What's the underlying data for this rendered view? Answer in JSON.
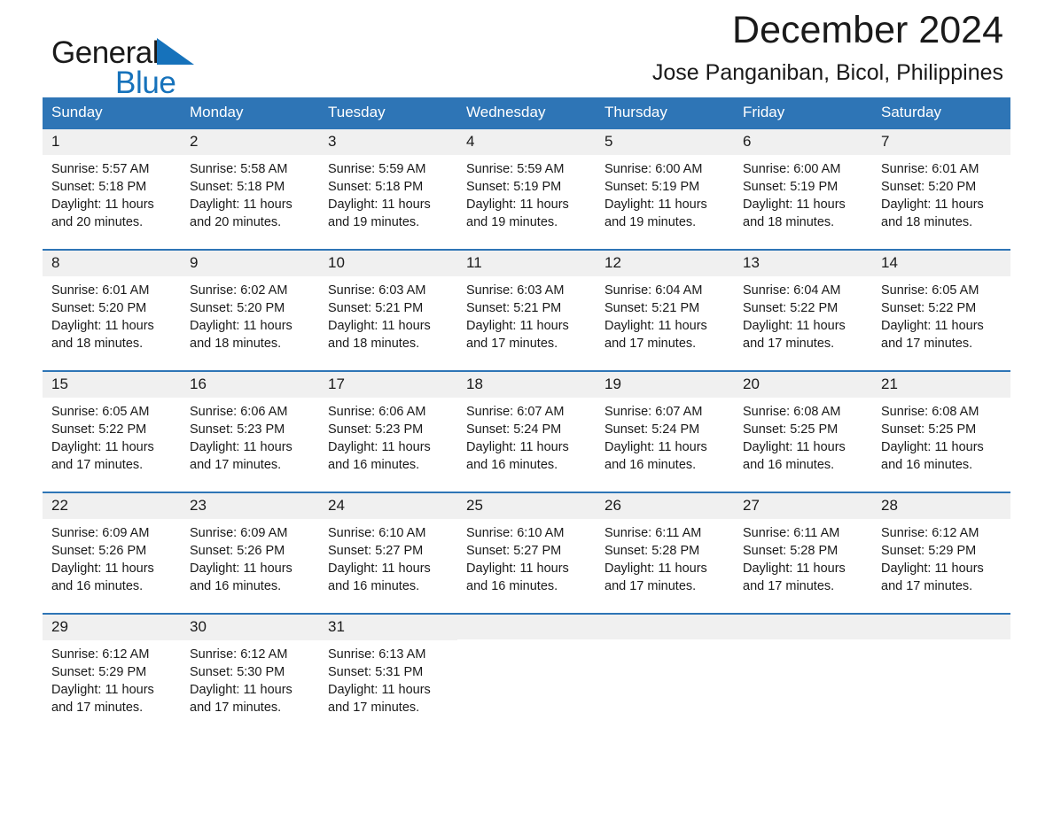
{
  "brand": {
    "name_part1": "General",
    "name_part2": "Blue",
    "triangle_icon": "brand-triangle-icon",
    "colors": {
      "black": "#1a1a1a",
      "blue": "#1672bb"
    }
  },
  "header": {
    "title": "December 2024",
    "subtitle": "Jose Panganiban, Bicol, Philippines"
  },
  "colors": {
    "header_blue": "#2e75b6",
    "date_band": "#f0f0f0",
    "text": "#1a1a1a",
    "header_text": "#ffffff"
  },
  "weekdays": [
    "Sunday",
    "Monday",
    "Tuesday",
    "Wednesday",
    "Thursday",
    "Friday",
    "Saturday"
  ],
  "weeks": [
    [
      {
        "day": "1",
        "sunrise": "Sunrise: 5:57 AM",
        "sunset": "Sunset: 5:18 PM",
        "daylight_line1": "Daylight: 11 hours",
        "daylight_line2": "and 20 minutes."
      },
      {
        "day": "2",
        "sunrise": "Sunrise: 5:58 AM",
        "sunset": "Sunset: 5:18 PM",
        "daylight_line1": "Daylight: 11 hours",
        "daylight_line2": "and 20 minutes."
      },
      {
        "day": "3",
        "sunrise": "Sunrise: 5:59 AM",
        "sunset": "Sunset: 5:18 PM",
        "daylight_line1": "Daylight: 11 hours",
        "daylight_line2": "and 19 minutes."
      },
      {
        "day": "4",
        "sunrise": "Sunrise: 5:59 AM",
        "sunset": "Sunset: 5:19 PM",
        "daylight_line1": "Daylight: 11 hours",
        "daylight_line2": "and 19 minutes."
      },
      {
        "day": "5",
        "sunrise": "Sunrise: 6:00 AM",
        "sunset": "Sunset: 5:19 PM",
        "daylight_line1": "Daylight: 11 hours",
        "daylight_line2": "and 19 minutes."
      },
      {
        "day": "6",
        "sunrise": "Sunrise: 6:00 AM",
        "sunset": "Sunset: 5:19 PM",
        "daylight_line1": "Daylight: 11 hours",
        "daylight_line2": "and 18 minutes."
      },
      {
        "day": "7",
        "sunrise": "Sunrise: 6:01 AM",
        "sunset": "Sunset: 5:20 PM",
        "daylight_line1": "Daylight: 11 hours",
        "daylight_line2": "and 18 minutes."
      }
    ],
    [
      {
        "day": "8",
        "sunrise": "Sunrise: 6:01 AM",
        "sunset": "Sunset: 5:20 PM",
        "daylight_line1": "Daylight: 11 hours",
        "daylight_line2": "and 18 minutes."
      },
      {
        "day": "9",
        "sunrise": "Sunrise: 6:02 AM",
        "sunset": "Sunset: 5:20 PM",
        "daylight_line1": "Daylight: 11 hours",
        "daylight_line2": "and 18 minutes."
      },
      {
        "day": "10",
        "sunrise": "Sunrise: 6:03 AM",
        "sunset": "Sunset: 5:21 PM",
        "daylight_line1": "Daylight: 11 hours",
        "daylight_line2": "and 18 minutes."
      },
      {
        "day": "11",
        "sunrise": "Sunrise: 6:03 AM",
        "sunset": "Sunset: 5:21 PM",
        "daylight_line1": "Daylight: 11 hours",
        "daylight_line2": "and 17 minutes."
      },
      {
        "day": "12",
        "sunrise": "Sunrise: 6:04 AM",
        "sunset": "Sunset: 5:21 PM",
        "daylight_line1": "Daylight: 11 hours",
        "daylight_line2": "and 17 minutes."
      },
      {
        "day": "13",
        "sunrise": "Sunrise: 6:04 AM",
        "sunset": "Sunset: 5:22 PM",
        "daylight_line1": "Daylight: 11 hours",
        "daylight_line2": "and 17 minutes."
      },
      {
        "day": "14",
        "sunrise": "Sunrise: 6:05 AM",
        "sunset": "Sunset: 5:22 PM",
        "daylight_line1": "Daylight: 11 hours",
        "daylight_line2": "and 17 minutes."
      }
    ],
    [
      {
        "day": "15",
        "sunrise": "Sunrise: 6:05 AM",
        "sunset": "Sunset: 5:22 PM",
        "daylight_line1": "Daylight: 11 hours",
        "daylight_line2": "and 17 minutes."
      },
      {
        "day": "16",
        "sunrise": "Sunrise: 6:06 AM",
        "sunset": "Sunset: 5:23 PM",
        "daylight_line1": "Daylight: 11 hours",
        "daylight_line2": "and 17 minutes."
      },
      {
        "day": "17",
        "sunrise": "Sunrise: 6:06 AM",
        "sunset": "Sunset: 5:23 PM",
        "daylight_line1": "Daylight: 11 hours",
        "daylight_line2": "and 16 minutes."
      },
      {
        "day": "18",
        "sunrise": "Sunrise: 6:07 AM",
        "sunset": "Sunset: 5:24 PM",
        "daylight_line1": "Daylight: 11 hours",
        "daylight_line2": "and 16 minutes."
      },
      {
        "day": "19",
        "sunrise": "Sunrise: 6:07 AM",
        "sunset": "Sunset: 5:24 PM",
        "daylight_line1": "Daylight: 11 hours",
        "daylight_line2": "and 16 minutes."
      },
      {
        "day": "20",
        "sunrise": "Sunrise: 6:08 AM",
        "sunset": "Sunset: 5:25 PM",
        "daylight_line1": "Daylight: 11 hours",
        "daylight_line2": "and 16 minutes."
      },
      {
        "day": "21",
        "sunrise": "Sunrise: 6:08 AM",
        "sunset": "Sunset: 5:25 PM",
        "daylight_line1": "Daylight: 11 hours",
        "daylight_line2": "and 16 minutes."
      }
    ],
    [
      {
        "day": "22",
        "sunrise": "Sunrise: 6:09 AM",
        "sunset": "Sunset: 5:26 PM",
        "daylight_line1": "Daylight: 11 hours",
        "daylight_line2": "and 16 minutes."
      },
      {
        "day": "23",
        "sunrise": "Sunrise: 6:09 AM",
        "sunset": "Sunset: 5:26 PM",
        "daylight_line1": "Daylight: 11 hours",
        "daylight_line2": "and 16 minutes."
      },
      {
        "day": "24",
        "sunrise": "Sunrise: 6:10 AM",
        "sunset": "Sunset: 5:27 PM",
        "daylight_line1": "Daylight: 11 hours",
        "daylight_line2": "and 16 minutes."
      },
      {
        "day": "25",
        "sunrise": "Sunrise: 6:10 AM",
        "sunset": "Sunset: 5:27 PM",
        "daylight_line1": "Daylight: 11 hours",
        "daylight_line2": "and 16 minutes."
      },
      {
        "day": "26",
        "sunrise": "Sunrise: 6:11 AM",
        "sunset": "Sunset: 5:28 PM",
        "daylight_line1": "Daylight: 11 hours",
        "daylight_line2": "and 17 minutes."
      },
      {
        "day": "27",
        "sunrise": "Sunrise: 6:11 AM",
        "sunset": "Sunset: 5:28 PM",
        "daylight_line1": "Daylight: 11 hours",
        "daylight_line2": "and 17 minutes."
      },
      {
        "day": "28",
        "sunrise": "Sunrise: 6:12 AM",
        "sunset": "Sunset: 5:29 PM",
        "daylight_line1": "Daylight: 11 hours",
        "daylight_line2": "and 17 minutes."
      }
    ],
    [
      {
        "day": "29",
        "sunrise": "Sunrise: 6:12 AM",
        "sunset": "Sunset: 5:29 PM",
        "daylight_line1": "Daylight: 11 hours",
        "daylight_line2": "and 17 minutes."
      },
      {
        "day": "30",
        "sunrise": "Sunrise: 6:12 AM",
        "sunset": "Sunset: 5:30 PM",
        "daylight_line1": "Daylight: 11 hours",
        "daylight_line2": "and 17 minutes."
      },
      {
        "day": "31",
        "sunrise": "Sunrise: 6:13 AM",
        "sunset": "Sunset: 5:31 PM",
        "daylight_line1": "Daylight: 11 hours",
        "daylight_line2": "and 17 minutes."
      },
      {
        "day": "",
        "sunrise": "",
        "sunset": "",
        "daylight_line1": "",
        "daylight_line2": ""
      },
      {
        "day": "",
        "sunrise": "",
        "sunset": "",
        "daylight_line1": "",
        "daylight_line2": ""
      },
      {
        "day": "",
        "sunrise": "",
        "sunset": "",
        "daylight_line1": "",
        "daylight_line2": ""
      },
      {
        "day": "",
        "sunrise": "",
        "sunset": "",
        "daylight_line1": "",
        "daylight_line2": ""
      }
    ]
  ]
}
